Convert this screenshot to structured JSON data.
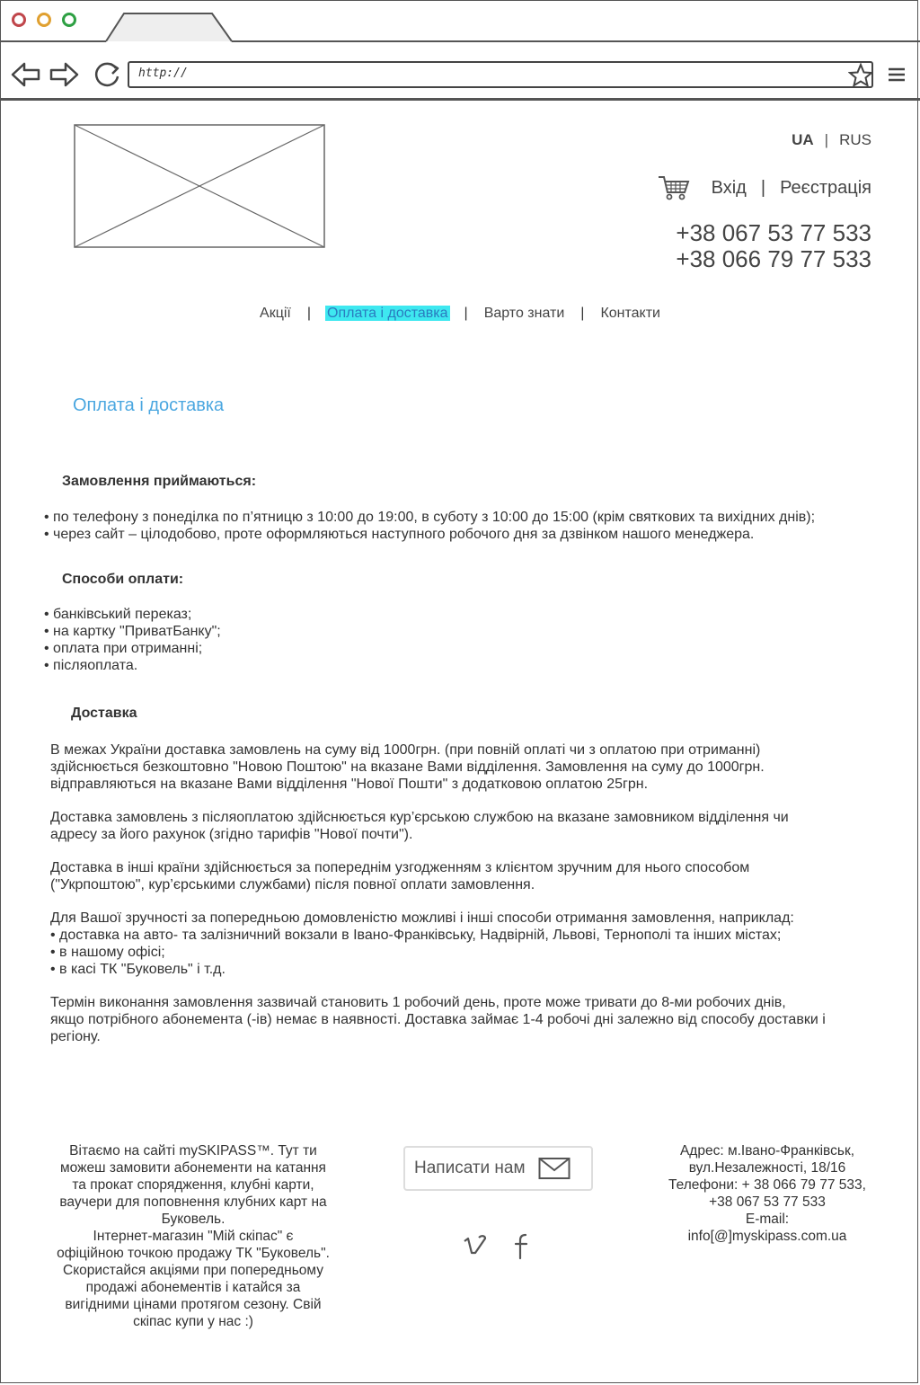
{
  "browser": {
    "url": "http://"
  },
  "header": {
    "lang_ua": "UA",
    "lang_sep": "|",
    "lang_rus": "RUS",
    "login": "Вхід",
    "auth_sep": "|",
    "register": "Реєстрація",
    "phone1": "+38 067 53 77 533",
    "phone2": "+38 066 79 77 533"
  },
  "nav": {
    "sep": "|",
    "items": [
      {
        "label": "Акції"
      },
      {
        "label": "Оплата і доставка"
      },
      {
        "label": "Варто знати"
      },
      {
        "label": "Контакти"
      }
    ]
  },
  "page": {
    "title": "Оплата і доставка",
    "orders_heading": "Замовлення приймаються:",
    "orders_items": [
      "• по телефону з понеділка по п’ятницю з 10:00 до 19:00, в суботу з 10:00 до 15:00 (крім святкових та вихідних днів);",
      "• через сайт – цілодобово, проте оформляються наступного робочого дня за дзвінком нашого менеджера."
    ],
    "payment_heading": "Способи оплати:",
    "payment_items": [
      "• банківський переказ;",
      "• на картку \"ПриватБанку\";",
      "• оплата при отриманні;",
      "• післяоплата."
    ],
    "delivery_heading": "Доставка",
    "delivery_p1": [
      "В межах України доставка замовлень на суму від 1000грн. (при повній оплаті чи з оплатою при отриманні)",
      "здійснюється безкоштовно \"Новою Поштою\" на вказане Вами відділення. Замовлення на суму до 1000грн.",
      "відправляються на вказане Вами відділення \"Нової Пошти\" з додатковою оплатою 25грн."
    ],
    "delivery_p2": [
      "Доставка замовлень з післяоплатою здійснюється кур’єрською службою на вказане замовником відділення чи",
      "адресу за його рахунок (згідно тарифів \"Нової почти\")."
    ],
    "delivery_p3": [
      "Доставка в інші країни здійснюється за попереднім узгодженням з клієнтом зручним для нього способом",
      "(\"Укрпоштою\", кур’єрськими службами) після повної оплати замовлення."
    ],
    "delivery_p4": [
      "Для Вашої зручності за попередньою домовленістю можливі і інші способи отримання замовлення, наприклад:",
      "• доставка на авто- та залізничний вокзали в Івано-Франківську, Надвірній, Львові, Тернополі та інших містах;",
      "• в нашому офісі;",
      "• в касі ТК \"Буковель\" і т.д."
    ],
    "delivery_p5": [
      "Термін виконання замовлення зазвичай становить 1 робочий день, проте може тривати до 8-ми робочих днів,",
      "якщо потрібного абонемента (-ів) немає в наявності. Доставка займає 1-4 робочі дні залежно від способу доставки і",
      "регіону."
    ]
  },
  "footer": {
    "about_lines": [
      "Вітаємо на сайті mySKIPASS™. Тут ти",
      "можеш замовити абонементи на катання",
      "та прокат спорядження, клубні карти,",
      "ваучери для поповнення клубних карт на",
      "Буковель.",
      "Інтернет-магазин \"Мій скіпас\" є",
      "офіційною точкою продажу ТК \"Буковель\".",
      "Скористайся акціями при попередньому",
      "продажі абонементів і катайся за",
      "вигідними цінами протягом сезону. Свій",
      "скіпас купи у нас :)"
    ],
    "write_us": "Написати нам",
    "contact_lines": [
      "Адрес: м.Івано-Франківськ,",
      "вул.Незалежності, 18/16",
      "Телефони: + 38 066 79 77 533,",
      "+38 067 53 77 533",
      "E-mail:",
      "info[@]myskipass.com.ua"
    ]
  },
  "colors": {
    "accent_title": "#4ba7e0",
    "nav_highlight": "#3ee8f0"
  }
}
